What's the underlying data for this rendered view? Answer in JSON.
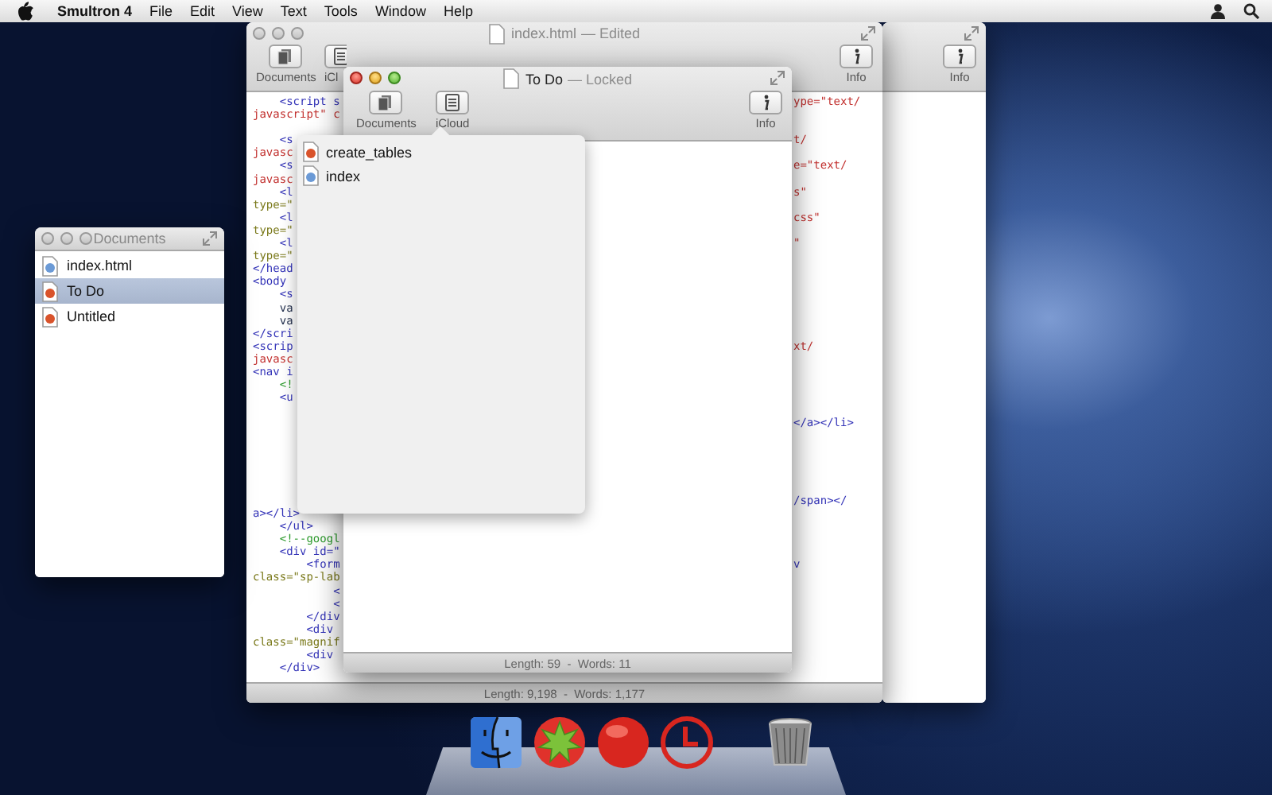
{
  "menu_bar": {
    "app_name": "Smultron 4",
    "items": [
      "File",
      "Edit",
      "View",
      "Text",
      "Tools",
      "Window",
      "Help"
    ]
  },
  "back_window": {
    "toolbar_buttons": [
      {
        "kind": "info",
        "label": "Info"
      }
    ]
  },
  "editor_window": {
    "active": false,
    "title": "index.html",
    "title_note": "— Edited",
    "toolbar_buttons": [
      {
        "kind": "documents",
        "label": "Documents"
      },
      {
        "kind": "icloud",
        "label": "iCl"
      },
      {
        "kind": "info",
        "label": "Info"
      }
    ],
    "code_lines": [
      {
        "left": {
          "text": "    <script s",
          "kind": "tag"
        },
        "right": {
          "text": "ype=\"text/",
          "kind": "string"
        }
      },
      {
        "left": {
          "text": "javascript\" c",
          "kind": "string"
        }
      },
      {
        "kind": "blank"
      },
      {
        "left": {
          "text": "    <s",
          "kind": "tag"
        },
        "right": {
          "text": "t/",
          "kind": "string"
        }
      },
      {
        "left": {
          "text": "javasc",
          "kind": "string"
        }
      },
      {
        "left": {
          "text": "    <s",
          "kind": "tag"
        },
        "right": {
          "text": "e=\"text/",
          "kind": "string"
        }
      },
      {
        "left": {
          "text": "javasc",
          "kind": "string"
        }
      },
      {
        "left": {
          "text": "    <l",
          "kind": "tag"
        },
        "right": {
          "text": "s\"",
          "kind": "string"
        }
      },
      {
        "left": {
          "text": "type=\"",
          "kind": "attr"
        }
      },
      {
        "left": {
          "text": "    <l",
          "kind": "tag"
        },
        "right": {
          "text": "css\"",
          "kind": "string"
        }
      },
      {
        "left": {
          "text": "type=\"",
          "kind": "attr"
        }
      },
      {
        "left": {
          "text": "    <l",
          "kind": "tag"
        },
        "right": {
          "text": "\"",
          "kind": "string"
        }
      },
      {
        "left": {
          "text": "type=\"",
          "kind": "attr"
        }
      },
      {
        "left": {
          "text": "</head",
          "kind": "tag"
        }
      },
      {
        "left": {
          "text": "<body",
          "kind": "tag"
        }
      },
      {
        "left": {
          "text": "    <s",
          "kind": "tag"
        }
      },
      {
        "left": {
          "text": "    va",
          "kind": "plain"
        }
      },
      {
        "left": {
          "text": "    va",
          "kind": "plain"
        }
      },
      {
        "left": {
          "text": "</scri",
          "kind": "tag"
        }
      },
      {
        "left": {
          "text": "<scrip",
          "kind": "tag"
        },
        "right": {
          "text": "xt/",
          "kind": "string"
        }
      },
      {
        "left": {
          "text": "javasc",
          "kind": "string"
        }
      },
      {
        "left": {
          "text": "<nav i",
          "kind": "tag"
        }
      },
      {
        "left": {
          "text": "    <!",
          "kind": "comment"
        }
      },
      {
        "left": {
          "text": "    <u",
          "kind": "tag"
        }
      },
      {
        "kind": "blank"
      },
      {
        "right": {
          "text": "</a></li>",
          "kind": "tag"
        }
      },
      {
        "kind": "blank"
      },
      {
        "kind": "blank"
      },
      {
        "kind": "blank"
      },
      {
        "kind": "blank"
      },
      {
        "kind": "blank"
      },
      {
        "right": {
          "text": "/span></",
          "kind": "tag"
        }
      },
      {
        "left": {
          "text": "a></li>",
          "kind": "tag"
        }
      },
      {
        "left": {
          "text": "    </ul>",
          "kind": "tag"
        }
      },
      {
        "left": {
          "text": "    <!--googl",
          "kind": "comment"
        }
      },
      {
        "left": {
          "text": "    <div id=\"",
          "kind": "tag"
        }
      },
      {
        "left": {
          "text": "        <form",
          "kind": "tag"
        },
        "right": {
          "text": "v",
          "kind": "tag"
        }
      },
      {
        "left": {
          "text": "class=\"sp-lab",
          "kind": "attr"
        }
      },
      {
        "left": {
          "text": "            <",
          "kind": "tag"
        }
      },
      {
        "left": {
          "text": "            <",
          "kind": "tag"
        }
      },
      {
        "left": {
          "text": "        </div",
          "kind": "tag"
        }
      },
      {
        "left": {
          "text": "        <div",
          "kind": "tag"
        }
      },
      {
        "left": {
          "text": "class=\"magnif",
          "kind": "attr"
        }
      },
      {
        "left": {
          "text": "        <div",
          "kind": "tag"
        }
      },
      {
        "left": {
          "text": "    </div>",
          "kind": "tag"
        }
      }
    ],
    "status": "Length: 9,198  -  Words: 1,177"
  },
  "todo_window": {
    "active": true,
    "title": "To Do",
    "title_note": "— Locked",
    "toolbar_buttons": [
      {
        "kind": "documents",
        "label": "Documents"
      },
      {
        "kind": "icloud",
        "label": "iCloud"
      },
      {
        "kind": "info",
        "label": "Info"
      }
    ],
    "status": "Length: 59  -  Words: 11"
  },
  "icloud_popover": {
    "items": [
      {
        "label": "create_tables",
        "color": "#d9532b"
      },
      {
        "label": "index",
        "color": "#6b9ad6"
      }
    ]
  },
  "documents_window": {
    "active": false,
    "title": "Documents",
    "items": [
      {
        "label": "index.html",
        "color": "#6b9ad6",
        "selected": false
      },
      {
        "label": "To Do",
        "color": "#d9532b",
        "selected": true
      },
      {
        "label": "Untitled",
        "color": "#d9532b",
        "selected": false
      }
    ]
  },
  "dock": {
    "items": [
      {
        "kind": "finder"
      },
      {
        "kind": "tomato"
      },
      {
        "kind": "ball"
      },
      {
        "kind": "clock"
      },
      {
        "kind": "trash"
      }
    ]
  }
}
